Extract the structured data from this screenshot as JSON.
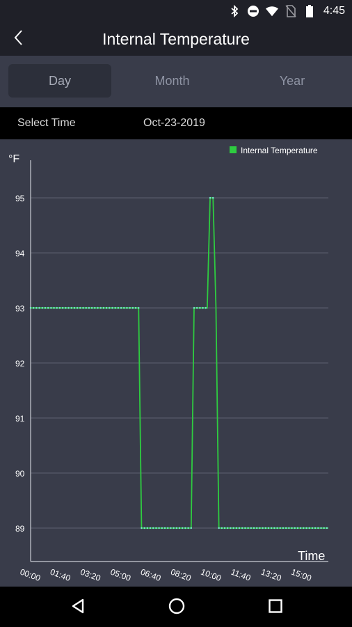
{
  "status_bar": {
    "time": "4:45",
    "icons": [
      "bluetooth-icon",
      "do-not-disturb-icon",
      "wifi-icon",
      "no-sim-icon",
      "battery-icon"
    ]
  },
  "app_bar": {
    "title": "Internal Temperature",
    "back_icon": "chevron-left-icon"
  },
  "tabs": [
    {
      "label": "Day",
      "active": true
    },
    {
      "label": "Month",
      "active": false
    },
    {
      "label": "Year",
      "active": false
    }
  ],
  "time_selector": {
    "label": "Select Time",
    "value": "Oct-23-2019"
  },
  "colors": {
    "line": "#2ecc40",
    "points": "#7fe0d8",
    "grid": "#5d6070",
    "axis": "#c9ccd4",
    "text": "#ffffff"
  },
  "chart_data": {
    "type": "line",
    "ylabel": "°F",
    "xlabel": "Time",
    "ylim": [
      89,
      95
    ],
    "y_ticks": [
      "95",
      "94",
      "93",
      "92",
      "91",
      "90",
      "89"
    ],
    "x_tick_labels": [
      "00:00",
      "01:40",
      "03:20",
      "05:00",
      "06:40",
      "08:20",
      "10:00",
      "11:40",
      "13:20",
      "15:00"
    ],
    "x_range_minutes": [
      0,
      1020
    ],
    "legend": "top-right",
    "grid": true,
    "series": [
      {
        "name": "Internal Temperature",
        "x_minutes": [
          0,
          370,
          380,
          550,
          560,
          605,
          615,
          625,
          635,
          645,
          1020
        ],
        "y": [
          93,
          93,
          89,
          89,
          93,
          93,
          95,
          95,
          93,
          89,
          89
        ]
      }
    ]
  },
  "nav_bar": {
    "icons": [
      "back-triangle-icon",
      "home-circle-icon",
      "recents-square-icon"
    ]
  }
}
